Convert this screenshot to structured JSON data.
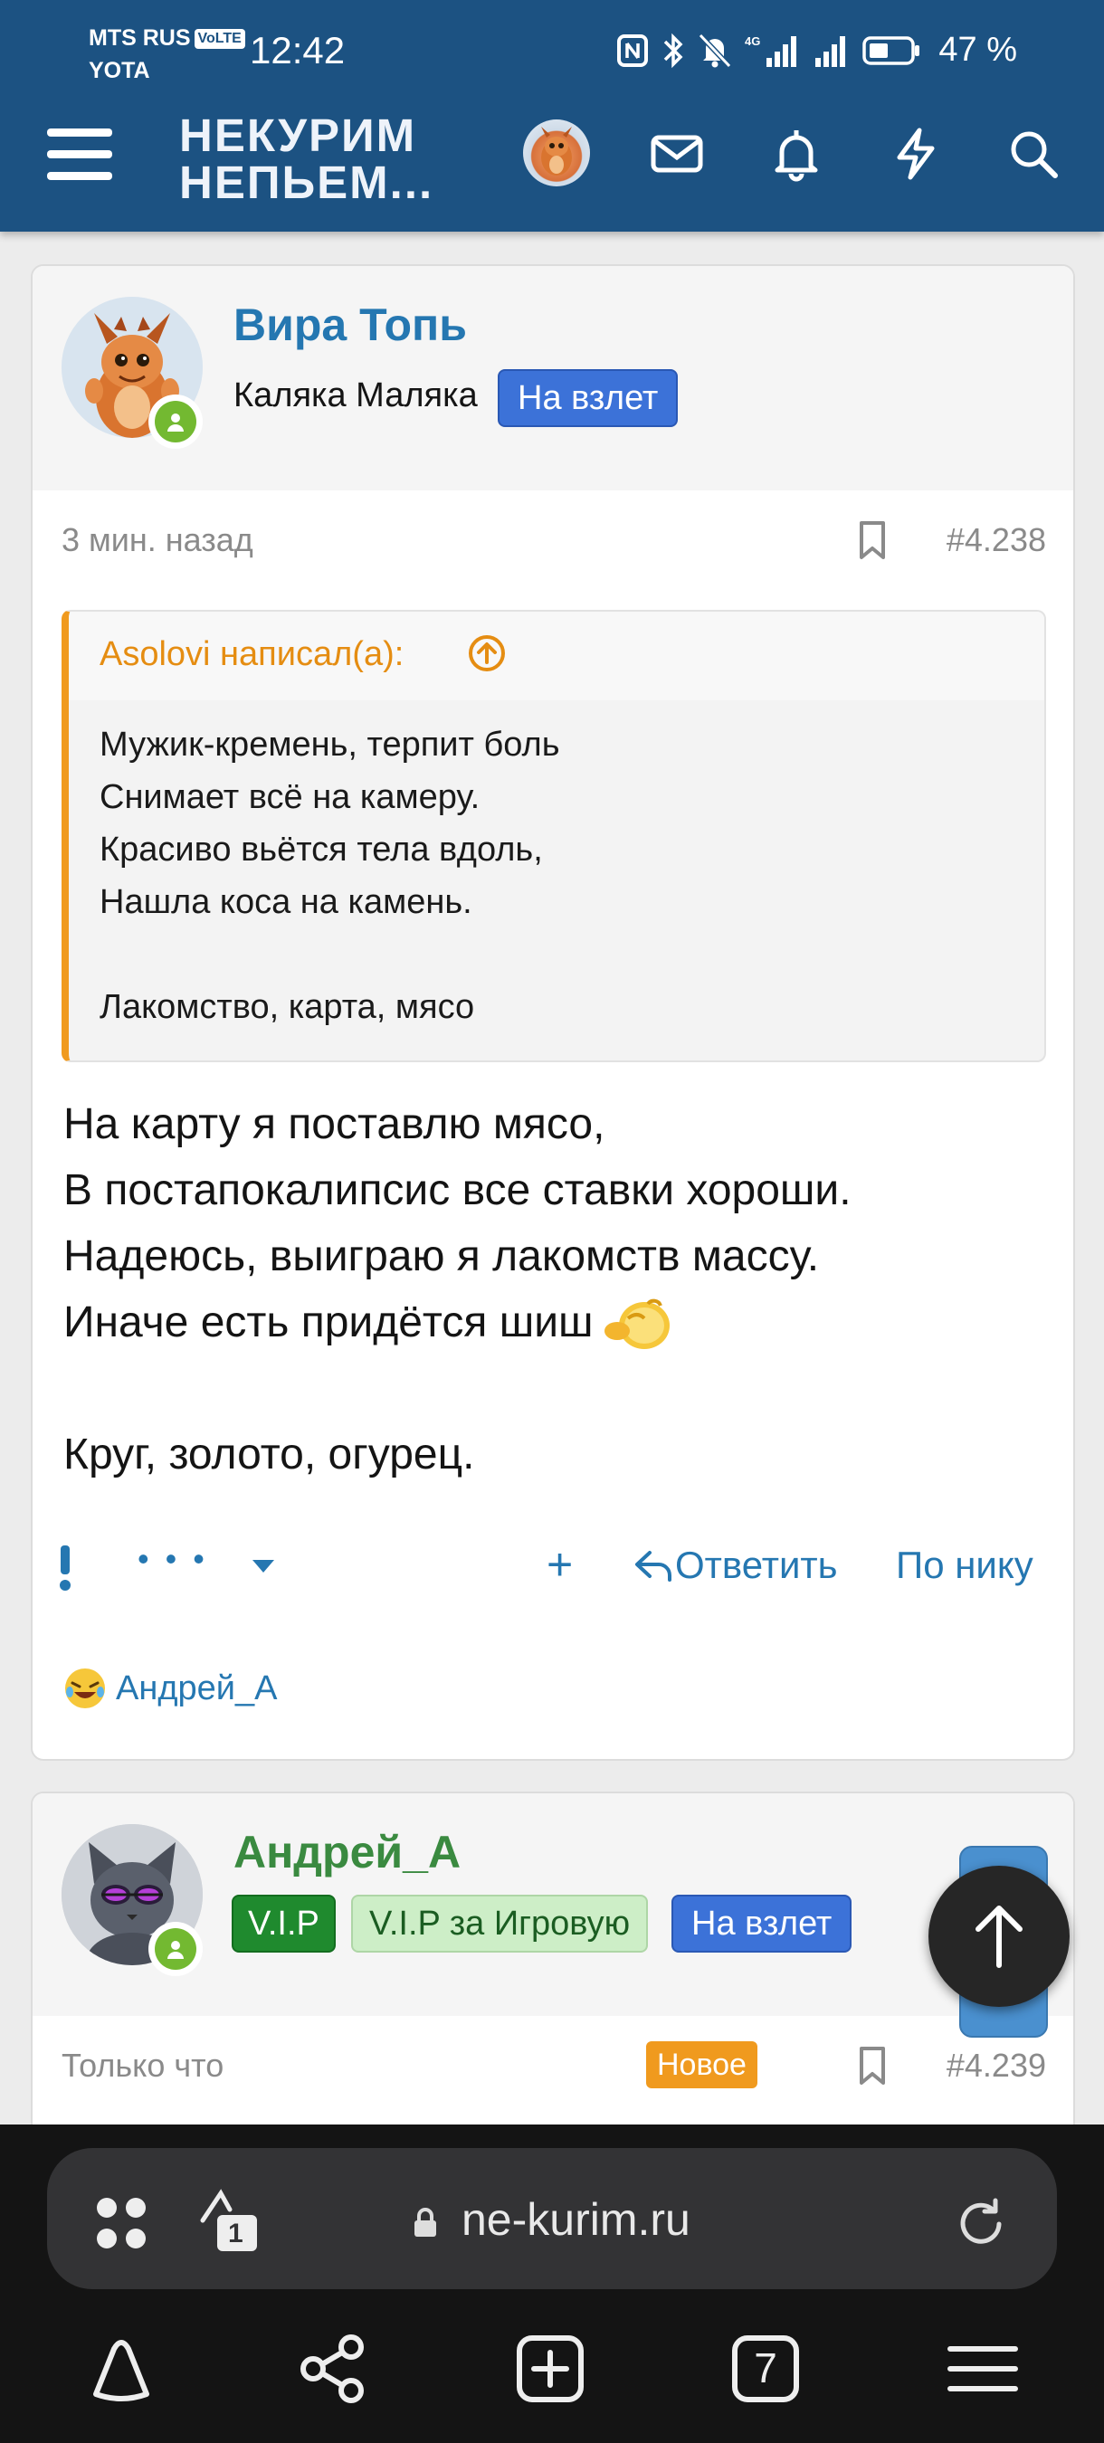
{
  "status_bar": {
    "carrier1": "MTS RUS",
    "volte": "VoLTE",
    "carrier2": "YOTA",
    "time": "12:42",
    "battery_percent": "47 %"
  },
  "header": {
    "logo_line1": "НЕКУРИМ",
    "logo_line2": "НЕПЬЕМ...",
    "icons": [
      "mail-icon",
      "bell-icon",
      "lightning-icon",
      "search-icon"
    ],
    "brand_color": "#1c5282"
  },
  "posts": [
    {
      "username": "Вира Топь",
      "user_title": "Каляка Маляка",
      "badges": [
        "На взлет"
      ],
      "time": "3 мин. назад",
      "number": "#4.238",
      "quote": {
        "author": "Asolovi написал(а):",
        "lines": [
          "Мужик-кремень, терпит боль",
          "Снимает всё на камеру.",
          "Красиво вьётся тела вдоль,",
          "Нашла коса на камень.",
          "Лакомство, карта, мясо"
        ]
      },
      "body": [
        "На карту я поставлю мясо,",
        "В постапокалипсис все ставки хороши.",
        "Надеюсь, выиграю я лакомств массу.",
        "Иначе есть придётся шиш",
        "Круг, золото, огурец."
      ],
      "actions": {
        "more": "• • •",
        "add": "+",
        "reply": "Ответить",
        "by_nick": "По нику"
      },
      "reactions_user": "Андрей_А"
    },
    {
      "username": "Андрей_А",
      "badges": [
        "V.I.P",
        "V.I.P за Игровую",
        "На взлет"
      ],
      "time": "Только что",
      "new_label": "Новое",
      "number": "#4.239"
    }
  ],
  "browser": {
    "url": "ne-kurim.ru",
    "tab_count_small": "1",
    "tabs_count": "7"
  }
}
